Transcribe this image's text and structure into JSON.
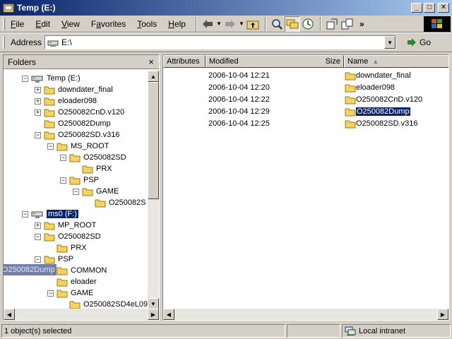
{
  "window": {
    "title": "Temp (E:)"
  },
  "menu": [
    "File",
    "Edit",
    "View",
    "Favorites",
    "Tools",
    "Help"
  ],
  "menu_underline_index": [
    0,
    0,
    0,
    1,
    0,
    0
  ],
  "address": {
    "label": "Address",
    "value": "E:\\",
    "go_label": "Go"
  },
  "folders_pane": {
    "title": "Folders",
    "close": "×"
  },
  "tree": [
    {
      "label": "Temp (E:)",
      "icon": "drive-icon",
      "expander": "−",
      "indent": 0
    },
    {
      "label": "downdater_final",
      "icon": "folder-icon",
      "expander": "+",
      "indent": 1
    },
    {
      "label": "eloader098",
      "icon": "folder-icon",
      "expander": "+",
      "indent": 1
    },
    {
      "label": "O250082CnD.v120",
      "icon": "folder-icon",
      "expander": "+",
      "indent": 1
    },
    {
      "label": "O250082Dump",
      "icon": "folder-icon",
      "expander": "",
      "indent": 1
    },
    {
      "label": "O250082SD.v316",
      "icon": "folder-icon",
      "expander": "−",
      "indent": 1
    },
    {
      "label": "MS_ROOT",
      "icon": "folder-icon",
      "expander": "−",
      "indent": 2
    },
    {
      "label": "O250082SD",
      "icon": "folder-icon",
      "expander": "−",
      "indent": 3
    },
    {
      "label": "PRX",
      "icon": "folder-icon",
      "expander": "",
      "indent": 4
    },
    {
      "label": "PSP",
      "icon": "folder-icon",
      "expander": "−",
      "indent": 3
    },
    {
      "label": "GAME",
      "icon": "folder-icon",
      "expander": "−",
      "indent": 4
    },
    {
      "label": "O250082S",
      "icon": "folder-icon",
      "expander": "",
      "indent": 5
    },
    {
      "label": "ms0 (F:)",
      "icon": "drive-icon",
      "expander": "−",
      "indent": 0,
      "selected": true
    },
    {
      "label": "MP_ROOT",
      "icon": "folder-icon",
      "expander": "+",
      "indent": 1
    },
    {
      "label": "O250082SD",
      "icon": "folder-icon",
      "expander": "−",
      "indent": 1
    },
    {
      "label": "PRX",
      "icon": "folder-icon",
      "expander": "",
      "indent": 2
    },
    {
      "label": "PSP",
      "icon": "folder-icon",
      "expander": "−",
      "indent": 1
    },
    {
      "label": "COMMON",
      "icon": "folder-icon",
      "expander": "",
      "indent": 2
    },
    {
      "label": "eloader",
      "icon": "folder-icon",
      "expander": "",
      "indent": 2
    },
    {
      "label": "GAME",
      "icon": "folder-icon",
      "expander": "−",
      "indent": 2
    },
    {
      "label": "O250082SD4eL09",
      "icon": "folder-icon",
      "expander": "",
      "indent": 3
    }
  ],
  "drag_ghost": {
    "label": "O250082Dump"
  },
  "columns": {
    "attributes": "Attributes",
    "modified": "Modified",
    "size": "Size",
    "name": "Name"
  },
  "files": [
    {
      "modified": "2006-10-04 12:21",
      "name": "downdater_final"
    },
    {
      "modified": "2006-10-04 12:20",
      "name": "eloader098"
    },
    {
      "modified": "2006-10-04 12:22",
      "name": "O250082CnD.v120"
    },
    {
      "modified": "2006-10-04 12:29",
      "name": "O250082Dump",
      "selected": true
    },
    {
      "modified": "2006-10-04 12:25",
      "name": "O250082SD.v316"
    }
  ],
  "status": {
    "left": "1 object(s) selected",
    "zone": "Local intranet"
  }
}
